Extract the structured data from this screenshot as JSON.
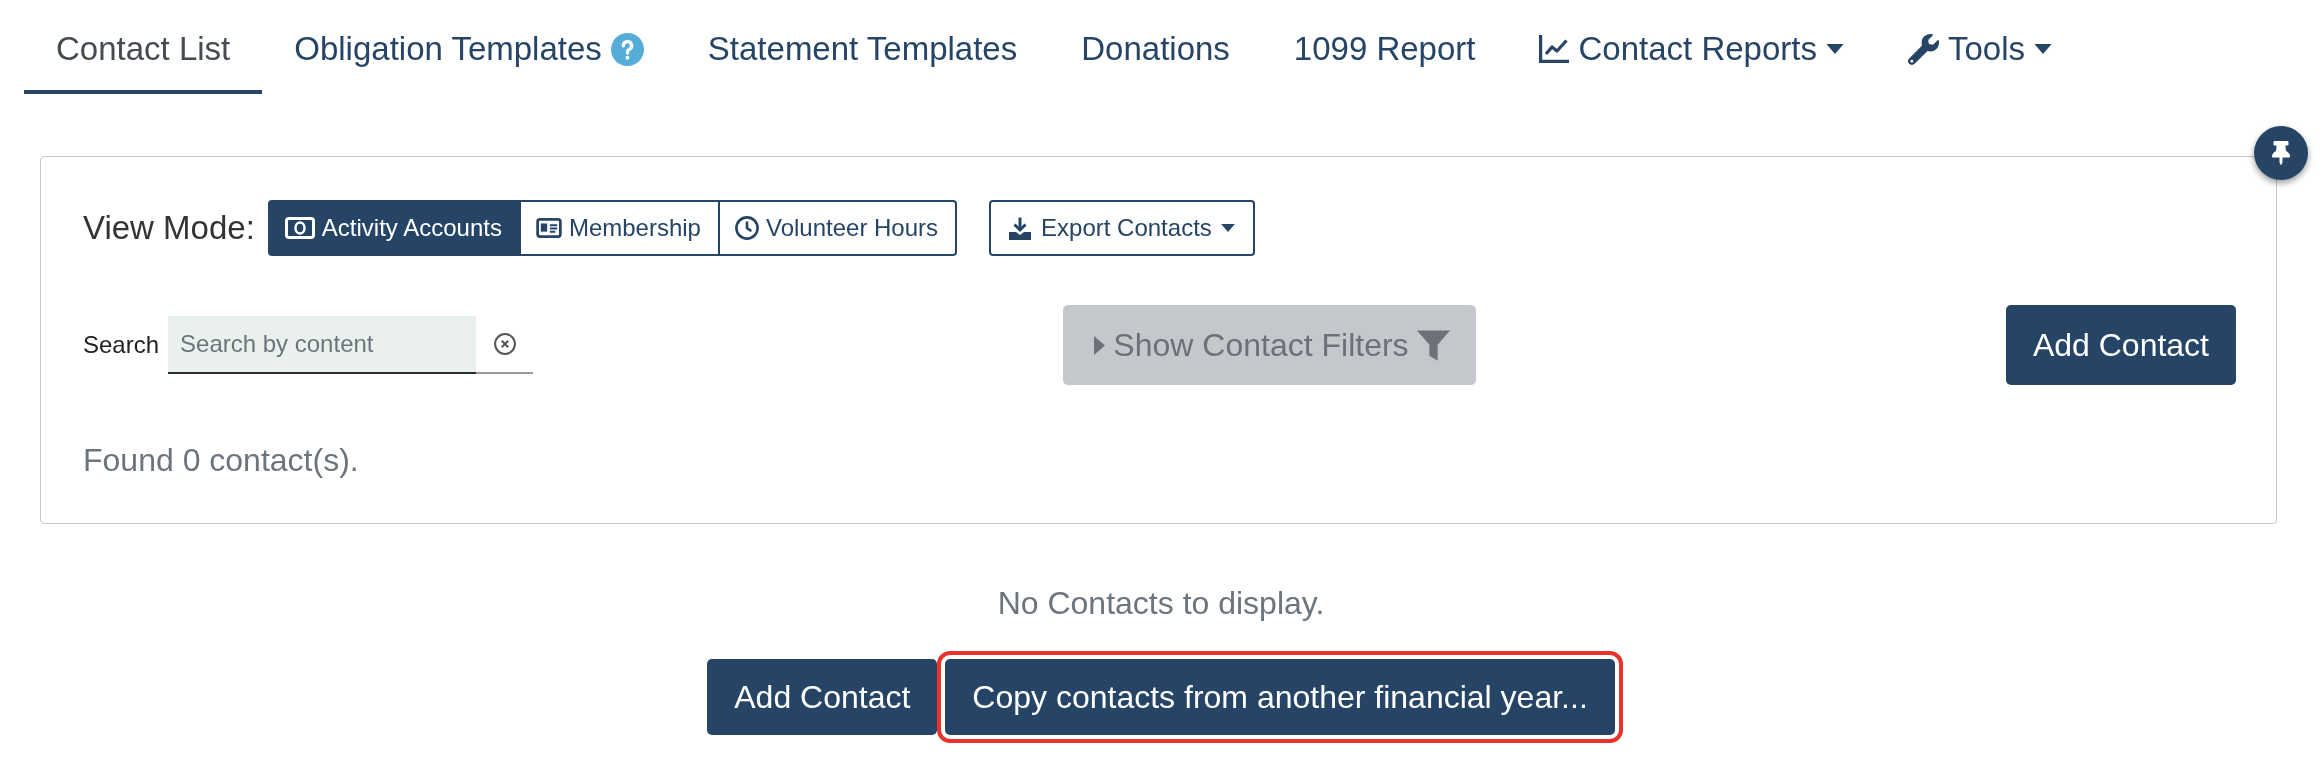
{
  "tabs": [
    {
      "label": "Contact List",
      "kind": "plain",
      "selected": true
    },
    {
      "label": "Obligation Templates",
      "kind": "help",
      "selected": false
    },
    {
      "label": "Statement Templates",
      "kind": "plain",
      "selected": false
    },
    {
      "label": "Donations",
      "kind": "plain",
      "selected": false
    },
    {
      "label": "1099 Report",
      "kind": "plain",
      "selected": false
    },
    {
      "label": "Contact Reports",
      "kind": "reports",
      "selected": false
    },
    {
      "label": "Tools",
      "kind": "tools",
      "selected": false
    }
  ],
  "view_mode": {
    "label": "View Mode:",
    "options": [
      {
        "label": "Activity Accounts",
        "kind": "accounts",
        "selected": true
      },
      {
        "label": "Membership",
        "kind": "membership",
        "selected": false
      },
      {
        "label": "Volunteer Hours",
        "kind": "hours",
        "selected": false
      }
    ]
  },
  "export_button": {
    "label": "Export Contacts"
  },
  "search": {
    "label": "Search",
    "placeholder": "Search by content"
  },
  "filters_button": {
    "label": "Show Contact Filters",
    "disabled": true
  },
  "add_contact_button": {
    "label": "Add Contact"
  },
  "result_count": "Found 0 contact(s).",
  "empty_state": {
    "message": "No Contacts to display.",
    "buttons": [
      {
        "label": "Add Contact",
        "highlighted": false
      },
      {
        "label": "Copy contacts from another financial year...",
        "highlighted": true
      }
    ]
  }
}
